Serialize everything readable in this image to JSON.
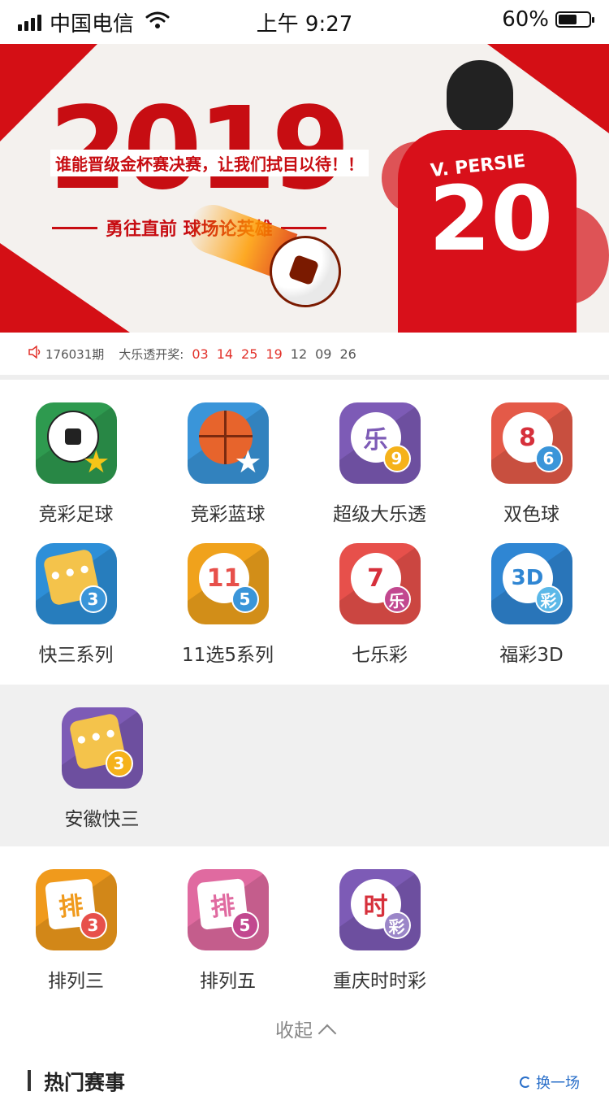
{
  "status_bar": {
    "carrier": "中国电信",
    "time": "上午 9:27",
    "battery_percent_text": "60%",
    "battery_level": 0.6
  },
  "banner": {
    "year": "2019",
    "slogan_top": "谁能晋级金杯赛决赛，让我们拭目以待！！",
    "slogan_bottom": "勇往直前 球场论英雄",
    "player_name": "V. PERSIE",
    "player_number": "20"
  },
  "draw_info": {
    "issue": "176031期",
    "game_label": "大乐透开奖:",
    "red_numbers": [
      "03",
      "14",
      "25",
      "19"
    ],
    "gray_numbers": [
      "12",
      "09",
      "26"
    ]
  },
  "games_row1": [
    {
      "label": "竞彩足球",
      "icon": "soccer-ball-icon",
      "bg": "#2e9a4f"
    },
    {
      "label": "竞彩蓝球",
      "icon": "basketball-icon",
      "bg": "#3a95d9"
    },
    {
      "label": "超级大乐透",
      "icon": "lotto-ball-icon",
      "bg": "#7d5bb6",
      "main": "乐",
      "sub": "9"
    },
    {
      "label": "双色球",
      "icon": "double-color-ball-icon",
      "bg": "#e45a48",
      "main": "8",
      "sub": "6"
    }
  ],
  "games_row2": [
    {
      "label": "快三系列",
      "icon": "dice-icon",
      "bg": "#2d8fd8",
      "sub": "3"
    },
    {
      "label": "11选5系列",
      "icon": "eleven-five-icon",
      "bg": "#f0a21c",
      "main": "11",
      "sub": "5"
    },
    {
      "label": "七乐彩",
      "icon": "seven-lotto-icon",
      "bg": "#e7504b",
      "main": "7",
      "sub": "乐"
    },
    {
      "label": "福彩3D",
      "icon": "fucai-3d-icon",
      "bg": "#2f86d3",
      "main": "3D",
      "sub": "彩"
    }
  ],
  "games_expanded": [
    {
      "label": "安徽快三",
      "icon": "dice-icon",
      "bg": "#7d5bb6",
      "sub": "3"
    }
  ],
  "games_row3": [
    {
      "label": "排列三",
      "icon": "pailie-three-icon",
      "bg": "#f09a1c",
      "main": "排",
      "sub": "3"
    },
    {
      "label": "排列五",
      "icon": "pailie-five-icon",
      "bg": "#e06aa0",
      "main": "排",
      "sub": "5"
    },
    {
      "label": "重庆时时彩",
      "icon": "shishicai-icon",
      "bg": "#7d5bb6",
      "main": "时",
      "sub": "彩"
    }
  ],
  "collapse_label": "收起",
  "hot_section": {
    "title": "热门赛事",
    "refresh_label": "换一场"
  }
}
